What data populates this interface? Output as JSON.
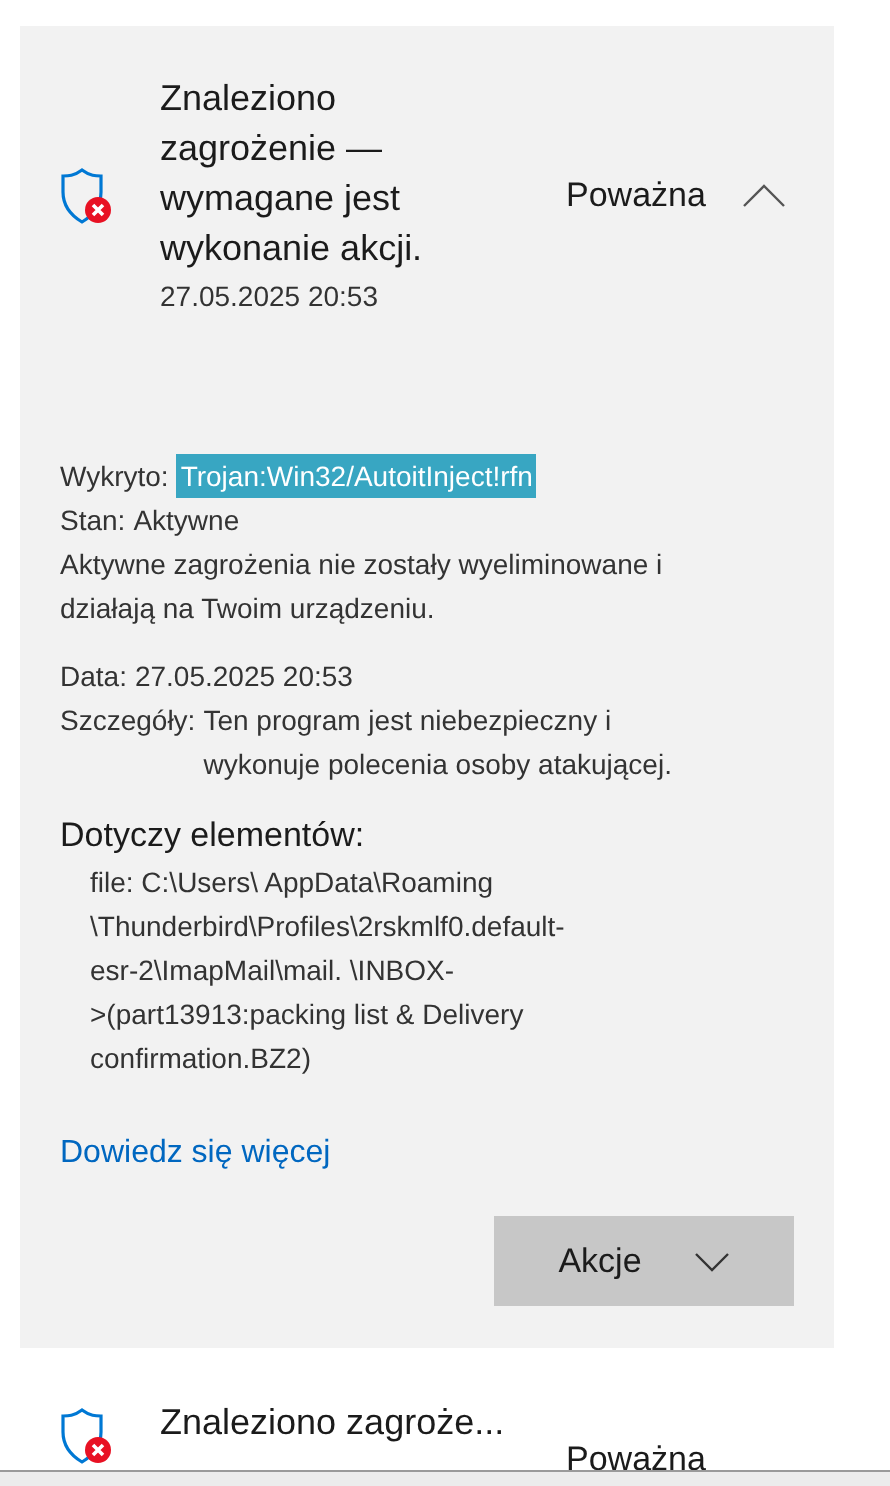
{
  "threat": {
    "title": "Znaleziono zagrożenie — wymagane jest wykonanie akcji.",
    "date": "27.05.2025 20:53",
    "severity": "Poważna",
    "expanded": true,
    "detected_label": "Wykryto:",
    "detected_value": "Trojan:Win32/AutoitInject!rfn",
    "status_label": "Stan:",
    "status_value": "Aktywne",
    "status_description": "Aktywne zagrożenia nie zostały wyeliminowane i działają na Twoim urządzeniu.",
    "date_label": "Data:",
    "date_value": "27.05.2025 20:53",
    "details_label": "Szczegóły:",
    "details_value": "Ten program jest niebezpieczny i wykonuje polecenia osoby atakującej.",
    "affected_heading": "Dotyczy elementów:",
    "affected_lines": [
      "file: C:\\Users\\ AppData\\Roaming",
      "\\Thunderbird\\Profiles\\2rskmlf0.default-",
      "esr-2\\ImapMail\\mail. \\INBOX-",
      ">(part13913:packing list & Delivery",
      "confirmation.BZ2)"
    ],
    "learn_more": "Dowiedz się więcej",
    "actions_button": "Akcje"
  },
  "next_threat": {
    "title": "Znaleziono zagroże...",
    "severity": "Poważna",
    "expanded": false
  }
}
